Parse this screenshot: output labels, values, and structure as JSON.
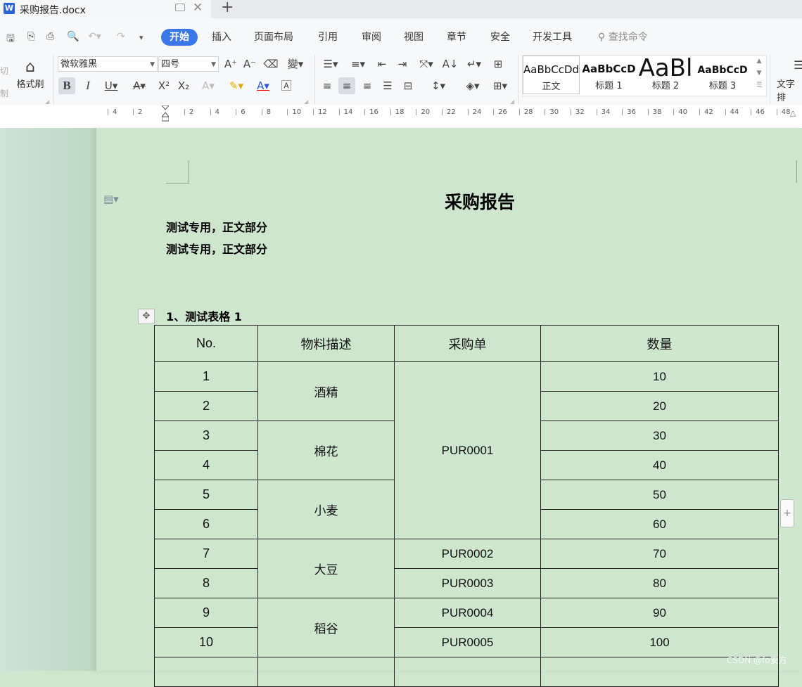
{
  "window": {
    "tab_title": "采购报告.docx",
    "app_logo": "W"
  },
  "ribbon": {
    "tabs": [
      {
        "label": "开始",
        "active": true
      },
      {
        "label": "插入"
      },
      {
        "label": "页面布局"
      },
      {
        "label": "引用"
      },
      {
        "label": "审阅"
      },
      {
        "label": "视图"
      },
      {
        "label": "章节"
      },
      {
        "label": "安全"
      },
      {
        "label": "开发工具"
      }
    ],
    "find_command": "查找命令",
    "format_painter": "格式刷",
    "cut_fragment_1": "切",
    "cut_fragment_2": "制",
    "font_name": "微软雅黑",
    "font_size": "四号",
    "styles": [
      {
        "sample": "AaBbCcDd",
        "name": "正文"
      },
      {
        "sample": "AaBbCcD",
        "name": "标题 1"
      },
      {
        "sample": "AaBl",
        "name": "标题 2"
      },
      {
        "sample": "AaBbCcD",
        "name": "标题 3"
      }
    ],
    "text_tools": "文字排"
  },
  "ruler": {
    "labels": [
      "4",
      "2",
      "2",
      "4",
      "6",
      "8",
      "10",
      "12",
      "14",
      "16",
      "18",
      "20",
      "22",
      "24",
      "26",
      "28",
      "30",
      "32",
      "34",
      "36",
      "38",
      "40",
      "42",
      "44",
      "46",
      "48"
    ]
  },
  "document": {
    "title": "采购报告",
    "body_lines": [
      "测试专用，正文部分",
      "测试专用，正文部分"
    ],
    "section_heading": "1、测试表格 1",
    "table": {
      "headers": [
        "No.",
        "物料描述",
        "采购单",
        "数量"
      ],
      "rows": [
        {
          "no": "1",
          "material": "酒精",
          "po": "PUR0001",
          "qty": "10"
        },
        {
          "no": "2",
          "material": "酒精",
          "po": "PUR0001",
          "qty": "20"
        },
        {
          "no": "3",
          "material": "棉花",
          "po": "PUR0001",
          "qty": "30"
        },
        {
          "no": "4",
          "material": "棉花",
          "po": "PUR0001",
          "qty": "40"
        },
        {
          "no": "5",
          "material": "小麦",
          "po": "PUR0001",
          "qty": "50"
        },
        {
          "no": "6",
          "material": "小麦",
          "po": "PUR0001",
          "qty": "60"
        },
        {
          "no": "7",
          "material": "大豆",
          "po": "PUR0002",
          "qty": "70"
        },
        {
          "no": "8",
          "material": "大豆",
          "po": "PUR0003",
          "qty": "80"
        },
        {
          "no": "9",
          "material": "稻谷",
          "po": "PUR0004",
          "qty": "90"
        },
        {
          "no": "10",
          "material": "稻谷",
          "po": "PUR0005",
          "qty": "100"
        }
      ]
    }
  },
  "watermark": "CSDN @fo安方",
  "colors": {
    "accent": "#3a78e8",
    "page_bg": "#cde6cd"
  }
}
